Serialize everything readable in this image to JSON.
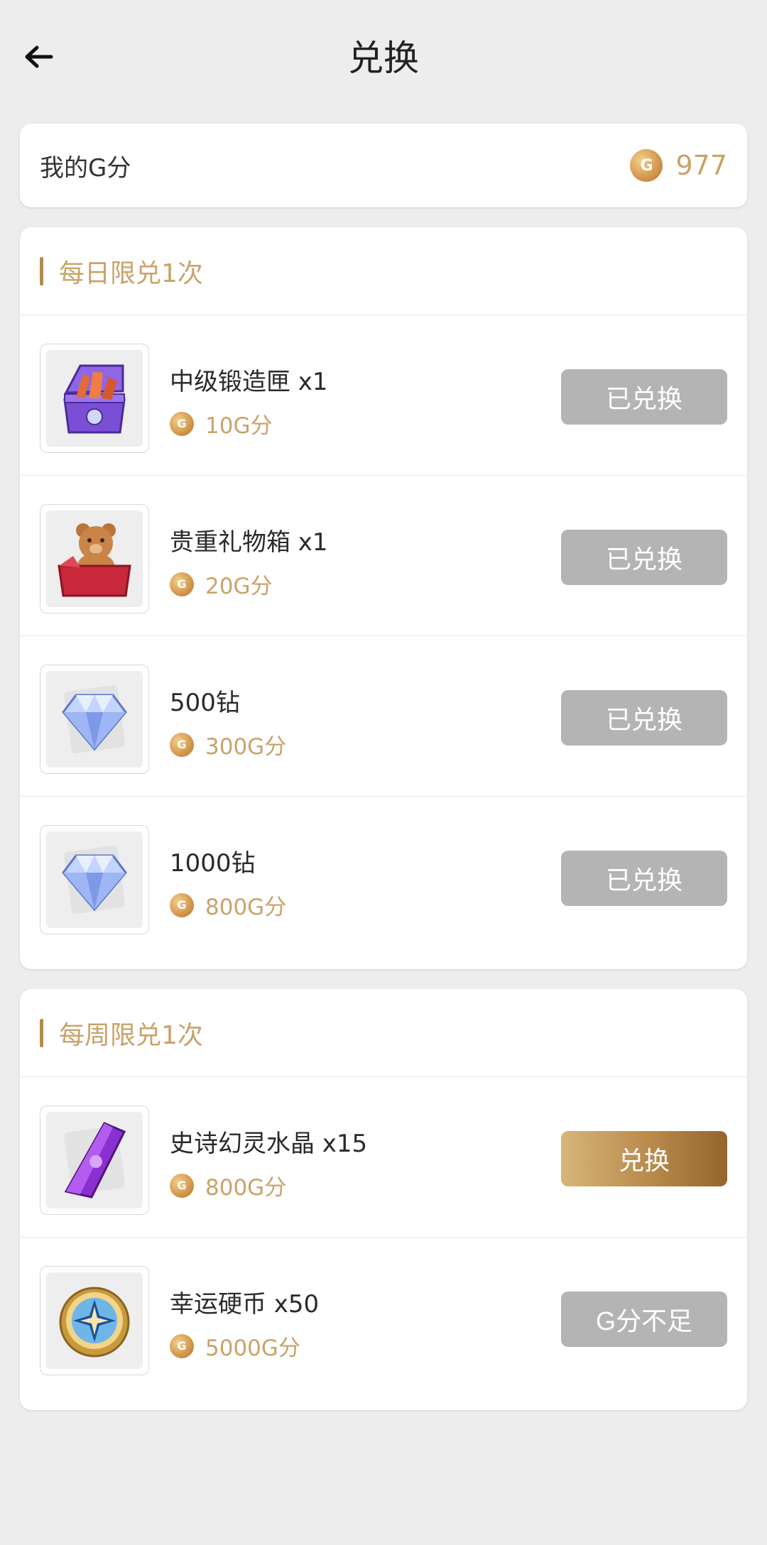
{
  "header": {
    "title": "兑换"
  },
  "balance": {
    "label": "我的G分",
    "coin_letter": "G",
    "value": "977"
  },
  "sections": {
    "daily": {
      "title": "每日限兑1次",
      "items": [
        {
          "name": "中级锻造匣 x1",
          "price": "10G分",
          "button": "已兑换",
          "icon": "forge-chest-icon"
        },
        {
          "name": "贵重礼物箱 x1",
          "price": "20G分",
          "button": "已兑换",
          "icon": "teddy-gift-box-icon"
        },
        {
          "name": "500钻",
          "price": "300G分",
          "button": "已兑换",
          "icon": "diamond-icon"
        },
        {
          "name": "1000钻",
          "price": "800G分",
          "button": "已兑换",
          "icon": "diamond-icon"
        }
      ]
    },
    "weekly": {
      "title": "每周限兑1次",
      "items": [
        {
          "name": "史诗幻灵水晶 x15",
          "price": "800G分",
          "button": "兑换",
          "icon": "purple-crystal-icon"
        },
        {
          "name": "幸运硬币 x50",
          "price": "5000G分",
          "button": "G分不足",
          "icon": "lucky-coin-icon"
        }
      ]
    }
  },
  "colors": {
    "accent_gold": "#c9a36a",
    "disabled_button": "#b4b4b4",
    "background": "#ededed"
  }
}
